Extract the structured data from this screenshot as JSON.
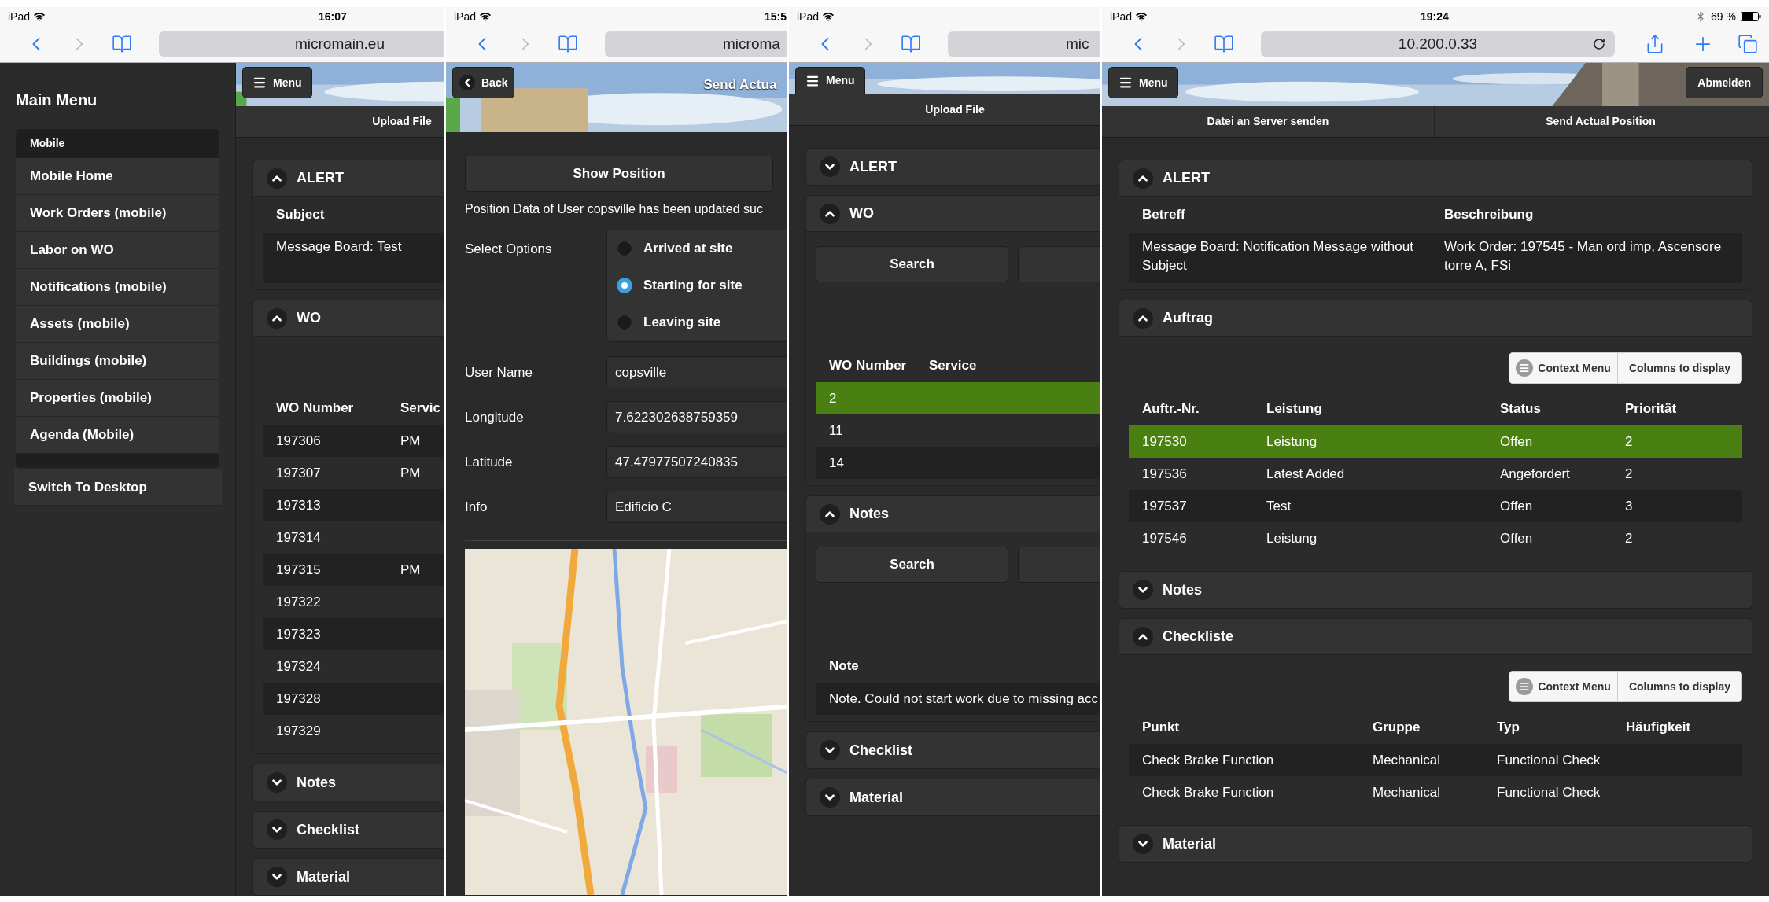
{
  "panels": [
    {
      "status_bar": {
        "device": "iPad",
        "time": "16:07"
      },
      "url": "micromain.eu",
      "sidebar": {
        "title": "Main Menu",
        "group": "Mobile",
        "items": [
          "Mobile Home",
          "Work Orders (mobile)",
          "Labor on WO",
          "Notifications (mobile)",
          "Assets (mobile)",
          "Buildings (mobile)",
          "Properties (mobile)",
          "Agenda (Mobile)"
        ],
        "footer": "Switch To Desktop"
      },
      "header": {
        "menu_button": "Menu"
      },
      "nav": [
        "Upload File"
      ],
      "sections": [
        {
          "title": "ALERT",
          "expanded": true,
          "kind": "alert",
          "table": {
            "columns": [
              "Subject"
            ],
            "rows": [
              {
                "cells": [
                  "Message Board: Test"
                ],
                "selected": false
              }
            ]
          }
        },
        {
          "title": "WO",
          "expanded": true,
          "kind": "list",
          "table": {
            "columns": [
              "WO Number",
              "Servic"
            ],
            "rows": [
              {
                "cells": [
                  "197306",
                  "PM"
                ],
                "selected": false
              },
              {
                "cells": [
                  "197307",
                  "PM"
                ],
                "selected": false
              },
              {
                "cells": [
                  "197313"
                ],
                "selected": false
              },
              {
                "cells": [
                  "197314"
                ],
                "selected": false
              },
              {
                "cells": [
                  "197315",
                  "PM"
                ],
                "selected": false
              },
              {
                "cells": [
                  "197322"
                ],
                "selected": false
              },
              {
                "cells": [
                  "197323"
                ],
                "selected": false
              },
              {
                "cells": [
                  "197324"
                ],
                "selected": false
              },
              {
                "cells": [
                  "197328"
                ],
                "selected": false
              },
              {
                "cells": [
                  "197329"
                ],
                "selected": false
              }
            ]
          }
        },
        {
          "title": "Notes",
          "expanded": false
        },
        {
          "title": "Checklist",
          "expanded": false
        },
        {
          "title": "Material",
          "expanded": false
        }
      ]
    },
    {
      "status_bar": {
        "device": "iPad",
        "time": "15:5"
      },
      "url": "microma",
      "header": {
        "back_button": "Back",
        "title": "Send Actua"
      },
      "position": {
        "show_button": "Show Position",
        "message": "Position Data of User copsville has been updated suc",
        "options_label": "Select Options",
        "options": [
          {
            "label": "Arrived at site",
            "selected": false
          },
          {
            "label": "Starting for site",
            "selected": true
          },
          {
            "label": "Leaving site",
            "selected": false
          }
        ],
        "fields": [
          {
            "label": "User Name",
            "value": "copsville"
          },
          {
            "label": "Longitude",
            "value": "7.622302638759359"
          },
          {
            "label": "Latitude",
            "value": "47.47977507240835"
          },
          {
            "label": "Info",
            "value": "Edificio C"
          }
        ]
      }
    },
    {
      "status_bar": {
        "device": "iPad"
      },
      "url": "mic",
      "header": {
        "menu_button": "Menu"
      },
      "nav": [
        "Upload File"
      ],
      "sections": [
        {
          "title": "ALERT",
          "expanded": false
        },
        {
          "title": "WO",
          "expanded": true,
          "kind": "list",
          "search_button": "Search",
          "table": {
            "columns": [
              "WO Number",
              "Service"
            ],
            "rows": [
              {
                "cells": [
                  "2"
                ],
                "selected": true
              },
              {
                "cells": [
                  "11"
                ],
                "selected": false
              },
              {
                "cells": [
                  "14"
                ],
                "selected": false
              }
            ]
          }
        },
        {
          "title": "Notes",
          "expanded": true,
          "kind": "list",
          "search_button": "Search",
          "table": {
            "columns": [
              "Note"
            ],
            "rows": [
              {
                "cells": [
                  "Note. Could not start work due to missing acc"
                ],
                "selected": false
              }
            ]
          }
        },
        {
          "title": "Checklist",
          "expanded": false
        },
        {
          "title": "Material",
          "expanded": false
        }
      ]
    },
    {
      "status_bar": {
        "device": "iPad",
        "time": "19:24",
        "battery": "69 %"
      },
      "url": "10.200.0.33",
      "header": {
        "menu_button": "Menu",
        "logout_button": "Abmelden"
      },
      "nav": [
        "Datei an Server senden",
        "Send Actual Position"
      ],
      "sections": [
        {
          "title": "ALERT",
          "expanded": true,
          "kind": "alert",
          "table": {
            "columns": [
              "Betreff",
              "Beschreibung"
            ],
            "rows": [
              {
                "cells": [
                  "Message Board: Notification Message without Subject",
                  "Work Order: 197545 - Man ord imp, Ascensore torre A, FSi"
                ],
                "selected": false
              }
            ]
          }
        },
        {
          "title": "Auftrag",
          "expanded": true,
          "kind": "list",
          "toolbar": {
            "context_menu": "Context Menu",
            "columns_button": "Columns to display"
          },
          "table": {
            "columns": [
              "Auftr.-Nr.",
              "Leistung",
              "Status",
              "Priorität"
            ],
            "rows": [
              {
                "cells": [
                  "197530",
                  "Leistung",
                  "Offen",
                  "2"
                ],
                "selected": true
              },
              {
                "cells": [
                  "197536",
                  "Latest Added",
                  "Angefordert",
                  "2"
                ],
                "selected": false
              },
              {
                "cells": [
                  "197537",
                  "Test",
                  "Offen",
                  "3"
                ],
                "selected": false
              },
              {
                "cells": [
                  "197546",
                  "Leistung",
                  "Offen",
                  "2"
                ],
                "selected": false
              }
            ]
          }
        },
        {
          "title": "Notes",
          "expanded": false
        },
        {
          "title": "Checkliste",
          "expanded": true,
          "kind": "list",
          "toolbar": {
            "context_menu": "Context Menu",
            "columns_button": "Columns to display"
          },
          "table": {
            "columns": [
              "Punkt",
              "Gruppe",
              "Typ",
              "Häufigkeit"
            ],
            "rows": [
              {
                "cells": [
                  "Check Brake Function",
                  "Mechanical",
                  "Functional Check"
                ],
                "selected": false
              },
              {
                "cells": [
                  "Check Brake Function",
                  "Mechanical",
                  "Functional Check"
                ],
                "selected": false
              }
            ]
          }
        },
        {
          "title": "Material",
          "expanded": false
        }
      ]
    }
  ]
}
